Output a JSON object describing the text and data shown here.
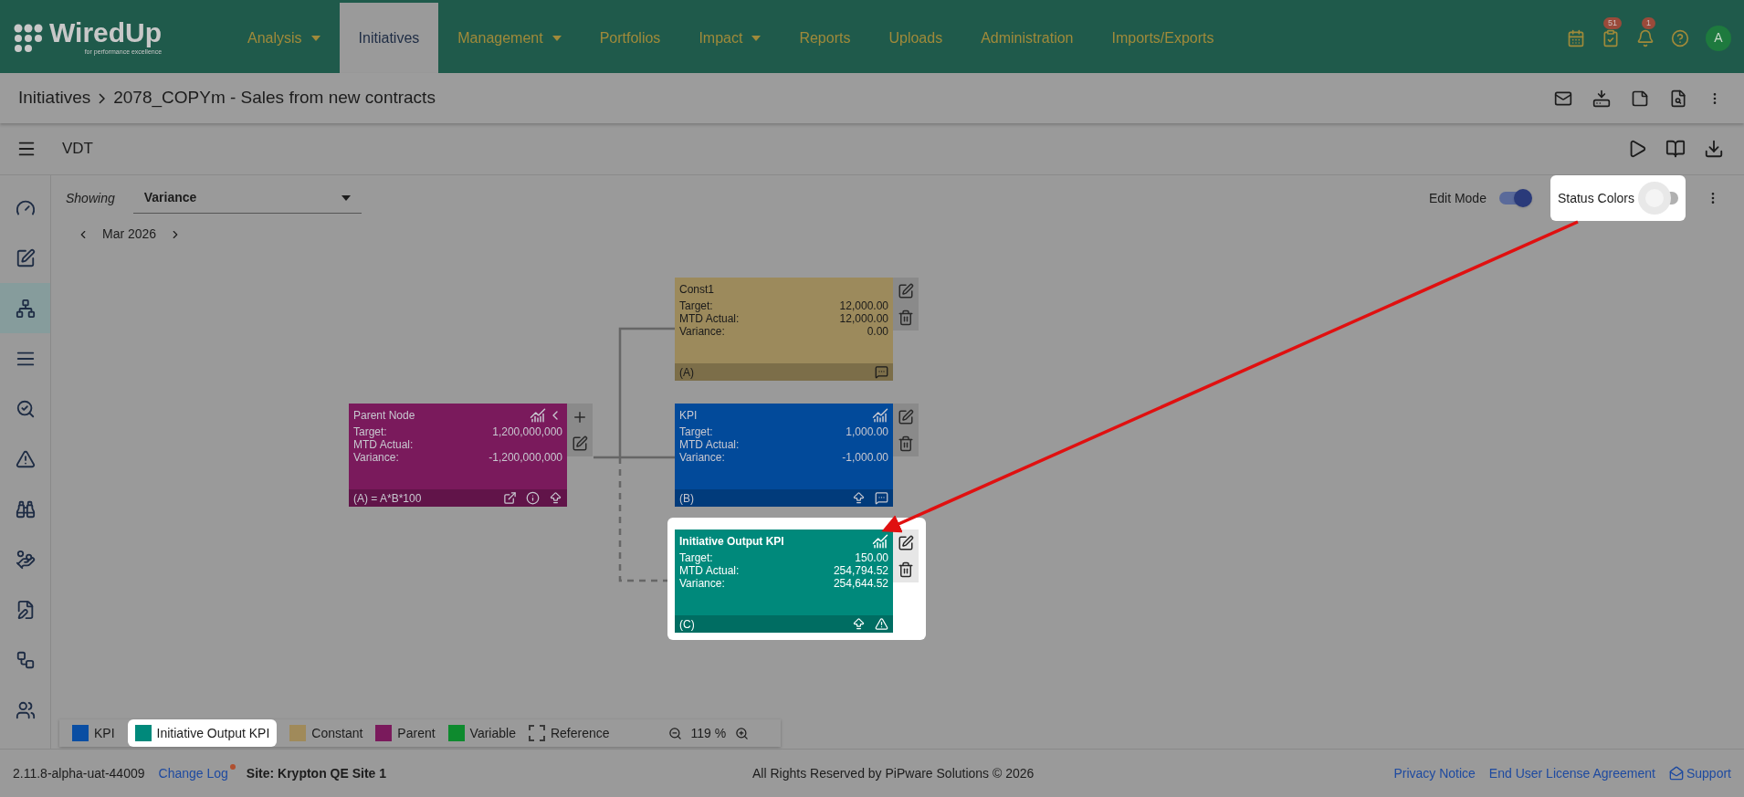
{
  "logo": {
    "name": "WiredUp",
    "tagline": "for performance excellence"
  },
  "nav": [
    {
      "label": "Analysis",
      "dropdown": true,
      "selected": false
    },
    {
      "label": "Initiatives",
      "dropdown": false,
      "selected": true
    },
    {
      "label": "Management",
      "dropdown": true,
      "selected": false
    },
    {
      "label": "Portfolios",
      "dropdown": false,
      "selected": false
    },
    {
      "label": "Impact",
      "dropdown": true,
      "selected": false
    },
    {
      "label": "Reports",
      "dropdown": false,
      "selected": false
    },
    {
      "label": "Uploads",
      "dropdown": false,
      "selected": false
    },
    {
      "label": "Administration",
      "dropdown": false,
      "selected": false
    },
    {
      "label": "Imports/Exports",
      "dropdown": false,
      "selected": false
    }
  ],
  "header_badges": {
    "tasks": "51",
    "notifications": "1"
  },
  "avatar": "A",
  "breadcrumb": [
    "Initiatives",
    "2078_COPYm - Sales from new contracts"
  ],
  "toolbar_title": "VDT",
  "sidebar": [
    {
      "selected": false
    },
    {
      "selected": false
    },
    {
      "selected": true
    },
    {
      "selected": false
    },
    {
      "selected": false
    },
    {
      "selected": false
    },
    {
      "selected": false
    },
    {
      "selected": false
    },
    {
      "selected": false
    },
    {
      "selected": false
    },
    {
      "selected": false
    }
  ],
  "showing": {
    "label": "Showing",
    "value": "Variance"
  },
  "edit_mode": {
    "label": "Edit Mode",
    "on": true
  },
  "status_colors": {
    "label": "Status Colors",
    "on": false,
    "highlighted": true
  },
  "period": "Mar 2026",
  "nodes": [
    {
      "kind": "constant",
      "title": "Const1",
      "color": "#9c8a5c",
      "highlighted": false,
      "rows": [
        {
          "label": "Target:",
          "value": "12,000.00"
        },
        {
          "label": "MTD Actual:",
          "value": "12,000.00"
        },
        {
          "label": "Variance:",
          "value": "0.00"
        }
      ],
      "footer": "(A)"
    },
    {
      "kind": "parent",
      "title": "Parent Node",
      "color": "#7a1a5c",
      "highlighted": false,
      "rows": [
        {
          "label": "Target:",
          "value": "1,200,000,000"
        },
        {
          "label": "MTD Actual:",
          "value": ""
        },
        {
          "label": "Variance:",
          "value": "-1,200,000,000"
        }
      ],
      "footer": "(A) = A*B*100"
    },
    {
      "kind": "kpi",
      "title": "KPI",
      "color": "#024a9a",
      "highlighted": false,
      "rows": [
        {
          "label": "Target:",
          "value": "1,000.00"
        },
        {
          "label": "MTD Actual:",
          "value": ""
        },
        {
          "label": "Variance:",
          "value": "-1,000.00"
        }
      ],
      "footer": "(B)"
    },
    {
      "kind": "output",
      "title": "Initiative Output KPI",
      "color": "#00897b",
      "highlighted": true,
      "rows": [
        {
          "label": "Target:",
          "value": "150.00"
        },
        {
          "label": "MTD Actual:",
          "value": "254,794.52"
        },
        {
          "label": "Variance:",
          "value": "254,644.52"
        }
      ],
      "footer": "(C)"
    }
  ],
  "legend": [
    {
      "kind": "solid",
      "label": "KPI",
      "color": "#0a4ea3",
      "highlighted": false
    },
    {
      "kind": "solid",
      "label": "Initiative Output KPI",
      "color": "#00897b",
      "highlighted": true
    },
    {
      "kind": "solid",
      "label": "Constant",
      "color": "#a08a5a",
      "highlighted": false
    },
    {
      "kind": "solid",
      "label": "Parent",
      "color": "#7a1a5c",
      "highlighted": false
    },
    {
      "kind": "solid",
      "label": "Variable",
      "color": "#0e8a2e",
      "highlighted": false
    },
    {
      "kind": "dashed",
      "label": "Reference",
      "color": "#3a3a3a",
      "highlighted": false
    }
  ],
  "zoom": "119 %",
  "footer": {
    "version": "2.11.8-alpha-uat-44009",
    "changelog": "Change Log",
    "site": "Site: Krypton QE Site 1",
    "copyright": "All Rights Reserved by PiPware Solutions © 2026",
    "links": [
      "Privacy Notice",
      "End User License Agreement"
    ],
    "support": "Support"
  }
}
